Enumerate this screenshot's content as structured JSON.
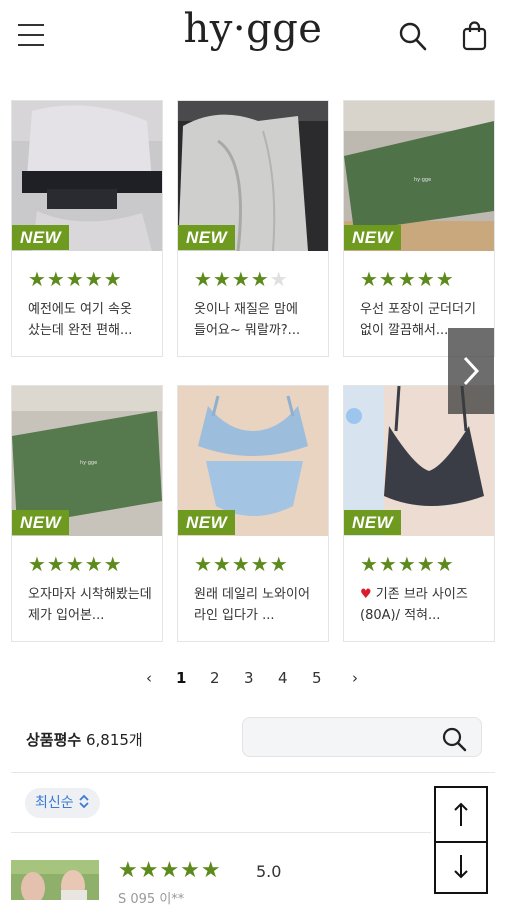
{
  "header": {
    "brand": "hy·gge",
    "icons": {
      "menu": "hamburger-icon",
      "search": "search-icon",
      "cart": "shopping-bag-icon"
    }
  },
  "photo_reviews": [
    {
      "badge": "NEW",
      "rating": 5,
      "stars": "★★★★★",
      "text": "예전에도 여기 속옷 샀는데 완전 편해..."
    },
    {
      "badge": "NEW",
      "rating": 4,
      "stars": "★★★★",
      "stars_off": "★",
      "text": "옷이나 재질은 맘에 들어요~ 뭐랄까?..."
    },
    {
      "badge": "NEW",
      "rating": 5,
      "stars": "★★★★★",
      "text": "우선 포장이 군더더기 없이 깔끔해서..."
    },
    {
      "badge": "NEW",
      "rating": 5,
      "stars": "★★★★★",
      "text": "오자마자 시착해봤는데 제가 입어본..."
    },
    {
      "badge": "NEW",
      "rating": 5,
      "stars": "★★★★★",
      "text": "원래 데일리 노와이어 라인 입다가 ..."
    },
    {
      "badge": "NEW",
      "rating": 5,
      "stars": "★★★★★",
      "heart": "♥",
      "text": "기존 브라 사이즈(80A)/ 적혀..."
    }
  ],
  "carousel": {
    "next_icon": "chevron-right-icon"
  },
  "pagination": {
    "prev": "‹",
    "pages": [
      "1",
      "2",
      "3",
      "4",
      "5"
    ],
    "active": "1",
    "next": "›"
  },
  "summary": {
    "label": "상품평수",
    "count": "6,815개"
  },
  "search": {
    "placeholder": "",
    "icon": "search-icon"
  },
  "sort": {
    "label": "최신순",
    "icon": "sort-updown-icon"
  },
  "scroll": {
    "up_icon": "arrow-up-icon",
    "down_icon": "arrow-down-icon"
  },
  "first_review": {
    "stars": "★★★★★",
    "score": "5.0",
    "meta": "S 095   이**"
  },
  "colors": {
    "accent_green": "#6e9a1f",
    "star_green": "#5d8a1c",
    "sort_blue": "#3a7bd5",
    "heart_red": "#d81e2c"
  }
}
